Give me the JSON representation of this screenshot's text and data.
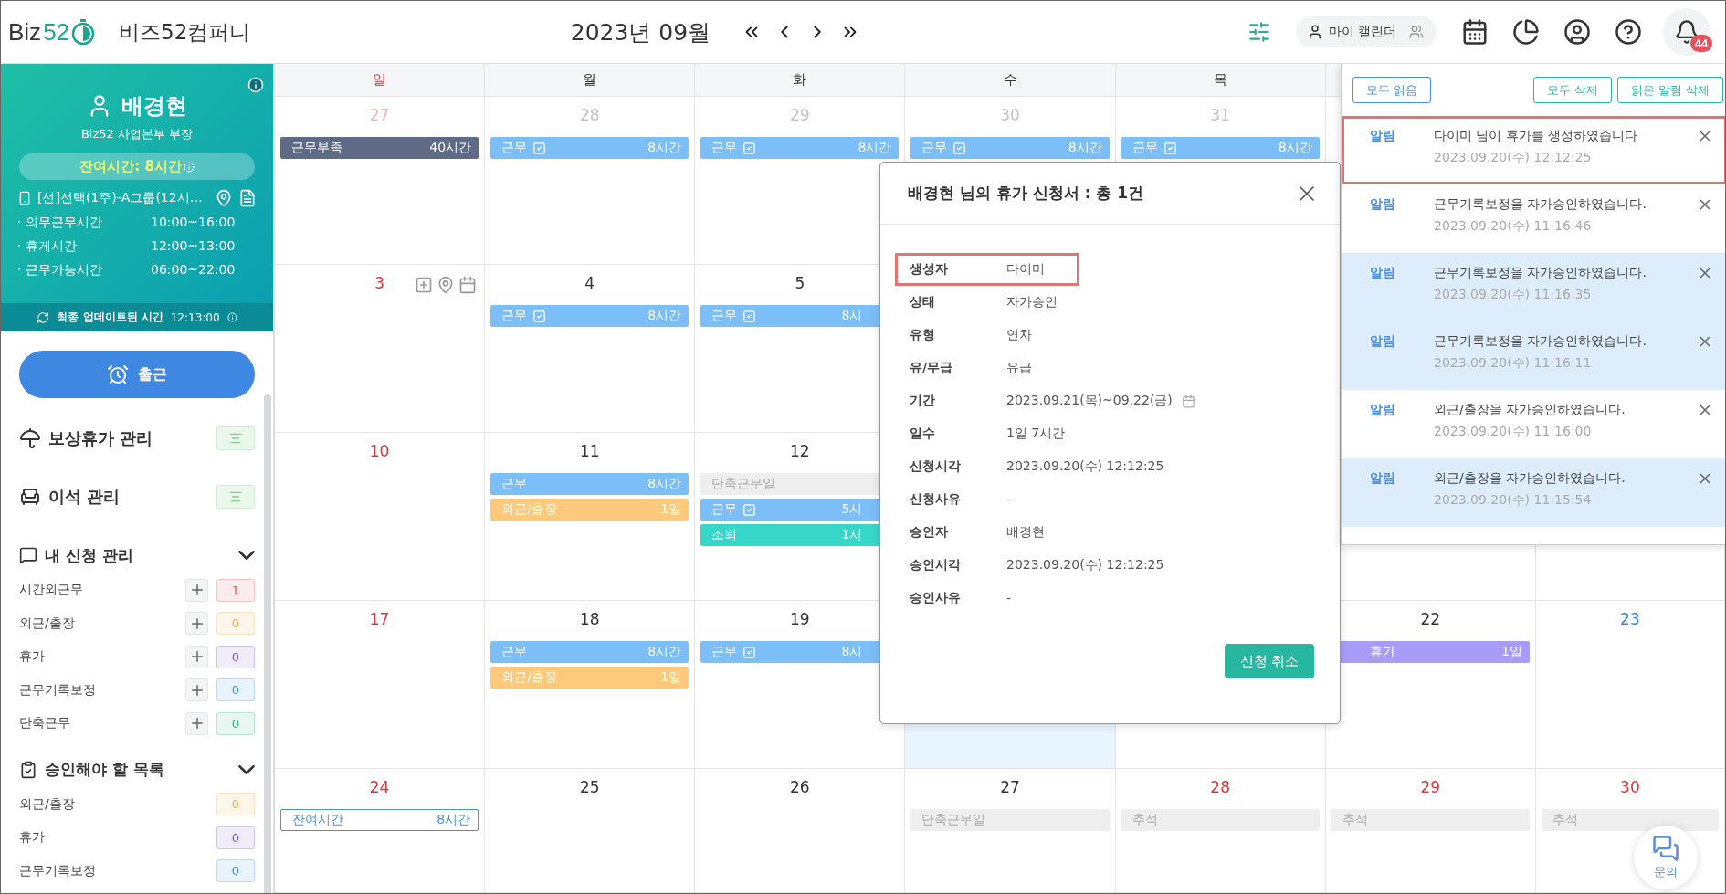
{
  "header": {
    "logo": {
      "text": "Biz",
      "accent": "52"
    },
    "company": "비즈52컴퍼니",
    "month": "2023년 09월",
    "my_calendar": "마이 캘린더",
    "bell_count": "44"
  },
  "profile": {
    "name": "배경현",
    "role": "Biz52 사업본부 부장",
    "remaining": "잔여시간: 8시간",
    "schedule": "[선]선택(1주)-A그룹(12시…",
    "times": [
      {
        "label": "· 의무근무시간",
        "value": "10:00~16:00"
      },
      {
        "label": "· 휴게시간",
        "value": "12:00~13:00"
      },
      {
        "label": "· 근무가능시간",
        "value": "06:00~22:00"
      }
    ],
    "update": {
      "label": "최종 업데이트된 시간",
      "time": "12:13:00"
    }
  },
  "checkin": "출근",
  "menus": [
    {
      "kind": "umbrella",
      "label": "보상휴가 관리"
    },
    {
      "kind": "seat",
      "label": "이석 관리"
    }
  ],
  "sections": [
    {
      "kind": "requests",
      "title": "내 신청 관리",
      "expanded": true,
      "items": [
        {
          "label": "시간외근무",
          "count": "1",
          "color": "#e8535a"
        },
        {
          "label": "외근/출장",
          "count": "0",
          "color": "#f5b04a"
        },
        {
          "label": "휴가",
          "count": "0",
          "color": "#7b52d6"
        },
        {
          "label": "근무기록보정",
          "count": "0",
          "color": "#3b8ff0"
        },
        {
          "label": "단축근무",
          "count": "0",
          "color": "#2bb58a"
        }
      ]
    },
    {
      "kind": "approvals",
      "title": "승인해야 할 목록",
      "expanded": true,
      "items": [
        {
          "label": "외근/출장",
          "count": "0",
          "color": "#f5b04a"
        },
        {
          "label": "휴가",
          "count": "0",
          "color": "#7b52d6"
        },
        {
          "label": "근무기록보정",
          "count": "0",
          "color": "#3b8ff0"
        }
      ]
    }
  ],
  "weekdays": [
    {
      "label": "일",
      "color": "#d33b3b"
    },
    {
      "label": "월",
      "color": "#333333"
    },
    {
      "label": "화",
      "color": "#333333"
    },
    {
      "label": "수",
      "color": "#333333"
    },
    {
      "label": "목",
      "color": "#333333"
    }
  ],
  "weeks": [
    {
      "days": [
        {
          "kind": "day",
          "date": "27",
          "color": "#f2b7b7",
          "events": [
            {
              "kind": "deficit",
              "label": "근무부족",
              "value": "40시간"
            }
          ]
        },
        {
          "kind": "day",
          "date": "28",
          "color": "#c4c4c4",
          "events": [
            {
              "kind": "work",
              "label": "근무",
              "check": true,
              "value": "8시간"
            }
          ]
        },
        {
          "kind": "day",
          "date": "29",
          "color": "#c4c4c4",
          "events": [
            {
              "kind": "work",
              "label": "근무",
              "check": true,
              "value": "8시간"
            }
          ]
        },
        {
          "kind": "day",
          "date": "30",
          "color": "#c4c4c4",
          "events": [
            {
              "kind": "work",
              "label": "근무",
              "check": true,
              "value": "8시간"
            }
          ]
        },
        {
          "kind": "day",
          "date": "31",
          "color": "#c4c4c4",
          "events": [
            {
              "kind": "work",
              "label": "근무",
              "check": true,
              "value": "8시간"
            }
          ]
        },
        {
          "kind": "covered"
        },
        {
          "kind": "covered"
        }
      ]
    },
    {
      "days": [
        {
          "kind": "day",
          "date": "3",
          "color": "#d33b3b",
          "tools": true
        },
        {
          "kind": "day",
          "date": "4",
          "color": "#333333",
          "events": [
            {
              "kind": "work",
              "label": "근무",
              "check": true,
              "value": "8시간"
            }
          ]
        },
        {
          "kind": "day",
          "date": "5",
          "color": "#333333",
          "events": [
            {
              "kind": "work",
              "label": "근무",
              "check": true,
              "value": "8시"
            }
          ]
        },
        {
          "kind": "covered"
        },
        {
          "kind": "covered"
        },
        {
          "kind": "covered"
        },
        {
          "kind": "covered"
        }
      ]
    },
    {
      "days": [
        {
          "kind": "day",
          "date": "10",
          "color": "#d33b3b"
        },
        {
          "kind": "day",
          "date": "11",
          "color": "#333333",
          "events": [
            {
              "kind": "work",
              "label": "근무",
              "check": false,
              "value": "8시간"
            },
            {
              "kind": "trip",
              "label": "외근/출장",
              "value": "1일"
            }
          ]
        },
        {
          "kind": "day",
          "date": "12",
          "color": "#333333",
          "events": [
            {
              "kind": "short",
              "label": "단축근무일"
            },
            {
              "kind": "work",
              "label": "근무",
              "check": true,
              "value": "5시"
            },
            {
              "kind": "early",
              "label": "조퇴",
              "value": "1시"
            }
          ]
        },
        {
          "kind": "covered"
        },
        {
          "kind": "covered"
        },
        {
          "kind": "covered"
        },
        {
          "kind": "covered"
        }
      ]
    },
    {
      "days": [
        {
          "kind": "day",
          "date": "17",
          "color": "#d33b3b"
        },
        {
          "kind": "day",
          "date": "18",
          "color": "#333333",
          "events": [
            {
              "kind": "work",
              "label": "근무",
              "check": false,
              "value": "8시간"
            },
            {
              "kind": "trip",
              "label": "외근/출장",
              "value": "1일"
            }
          ]
        },
        {
          "kind": "day",
          "date": "19",
          "color": "#333333",
          "events": [
            {
              "kind": "work",
              "label": "근무",
              "check": true,
              "value": "8시"
            }
          ]
        },
        {
          "kind": "covered",
          "today": true
        },
        {
          "kind": "covered",
          "today": false
        },
        {
          "kind": "day",
          "date": "22",
          "color": "#333333",
          "events": [
            {
              "kind": "leave",
              "label": "휴가",
              "value": "1일"
            }
          ]
        },
        {
          "kind": "day",
          "date": "23",
          "color": "#3a86d8"
        }
      ]
    },
    {
      "days": [
        {
          "kind": "day",
          "date": "24",
          "color": "#d33b3b",
          "events": [
            {
              "kind": "remain",
              "label": "잔여시간",
              "value": "8시간"
            }
          ]
        },
        {
          "kind": "day",
          "date": "25",
          "color": "#333333"
        },
        {
          "kind": "day",
          "date": "26",
          "color": "#333333"
        },
        {
          "kind": "day",
          "date": "27",
          "color": "#333333",
          "events": [
            {
              "kind": "short",
              "label": "단축근무일"
            }
          ]
        },
        {
          "kind": "day",
          "date": "28",
          "color": "#d33b3b",
          "events": [
            {
              "kind": "short",
              "label": "추석"
            }
          ]
        },
        {
          "kind": "day",
          "date": "29",
          "color": "#d33b3b",
          "events": [
            {
              "kind": "short",
              "label": "추석"
            }
          ]
        },
        {
          "kind": "day",
          "date": "30",
          "color": "#d33b3b",
          "events": [
            {
              "kind": "short",
              "label": "추석"
            }
          ]
        }
      ]
    }
  ],
  "modal": {
    "title": "배경현 님의 휴가 신청서 : 총 1건",
    "rows": [
      {
        "label": "생성자",
        "value": "다이미",
        "highlighted": true
      },
      {
        "label": "상태",
        "value": "자가승인",
        "highlighted": false
      },
      {
        "label": "유형",
        "value": "연차",
        "highlighted": false
      },
      {
        "label": "유/무급",
        "value": "유급",
        "highlighted": false
      },
      {
        "label": "기간",
        "value": "2023.09.21(목)~09.22(금)",
        "kind": "period",
        "highlighted": false
      },
      {
        "label": "일수",
        "value": "1일 7시간",
        "highlighted": false
      },
      {
        "label": "신청시각",
        "value": "2023.09.20(수) 12:12:25",
        "highlighted": false
      },
      {
        "label": "신청사유",
        "value": "-",
        "highlighted": false
      },
      {
        "label": "승인자",
        "value": "배경현",
        "highlighted": false
      },
      {
        "label": "승인시각",
        "value": "2023.09.20(수) 12:12:25",
        "highlighted": false
      },
      {
        "label": "승인사유",
        "value": "-",
        "highlighted": false
      }
    ],
    "button": "신청 취소"
  },
  "notifications": {
    "read_all": "모두 읽음",
    "delete_all": "모두 삭제",
    "delete_read": "읽은 알림 삭제",
    "items": [
      {
        "tag": "알림",
        "message": "다이미 님이 휴가를 생성하였습니다",
        "time": "2023.09.20(수) 12:12:25",
        "unread": false,
        "highlighted": true
      },
      {
        "tag": "알림",
        "message": "근무기록보정을 자가승인하였습니다.",
        "time": "2023.09.20(수) 11:16:46",
        "unread": false,
        "highlighted": false
      },
      {
        "tag": "알림",
        "message": "근무기록보정을 자가승인하였습니다.",
        "time": "2023.09.20(수) 11:16:35",
        "unread": true,
        "highlighted": false
      },
      {
        "tag": "알림",
        "message": "근무기록보정을 자가승인하였습니다.",
        "time": "2023.09.20(수) 11:16:11",
        "unread": true,
        "highlighted": false
      },
      {
        "tag": "알림",
        "message": "외근/출장을 자가승인하였습니다.",
        "time": "2023.09.20(수) 11:16:00",
        "unread": false,
        "highlighted": false
      },
      {
        "tag": "알림",
        "message": "외근/출장을 자가승인하였습니다.",
        "time": "2023.09.20(수) 11:15:54",
        "unread": true,
        "highlighted": false
      }
    ]
  },
  "chat": "문의"
}
